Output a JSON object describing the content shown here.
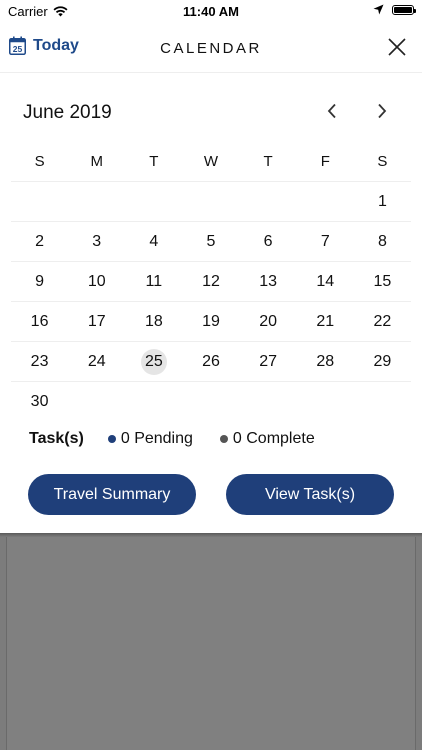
{
  "status_bar": {
    "carrier": "Carrier",
    "time": "11:40 AM"
  },
  "header": {
    "today_icon_day": "25",
    "today_label": "Today",
    "title": "CALENDAR"
  },
  "calendar": {
    "month_label": "June 2019",
    "weekdays": [
      "S",
      "M",
      "T",
      "W",
      "T",
      "F",
      "S"
    ],
    "selected_day": "25",
    "weeks": [
      [
        "",
        "",
        "",
        "",
        "",
        "",
        "1"
      ],
      [
        "2",
        "3",
        "4",
        "5",
        "6",
        "7",
        "8"
      ],
      [
        "9",
        "10",
        "11",
        "12",
        "13",
        "14",
        "15"
      ],
      [
        "16",
        "17",
        "18",
        "19",
        "20",
        "21",
        "22"
      ],
      [
        "23",
        "24",
        "25",
        "26",
        "27",
        "28",
        "29"
      ],
      [
        "30",
        "",
        "",
        "",
        "",
        "",
        ""
      ]
    ]
  },
  "tasks": {
    "label": "Task(s)",
    "pending": "0 Pending",
    "complete": "0 Complete",
    "pending_color": "#1f3f7a",
    "complete_color": "#555555"
  },
  "buttons": {
    "travel_summary": "Travel Summary",
    "view_tasks": "View Task(s)"
  },
  "colors": {
    "accent": "#1f4a8a",
    "button_bg": "#1f3f7a",
    "selected_day_bg": "#e5e5e5",
    "overlay": "#808080"
  }
}
